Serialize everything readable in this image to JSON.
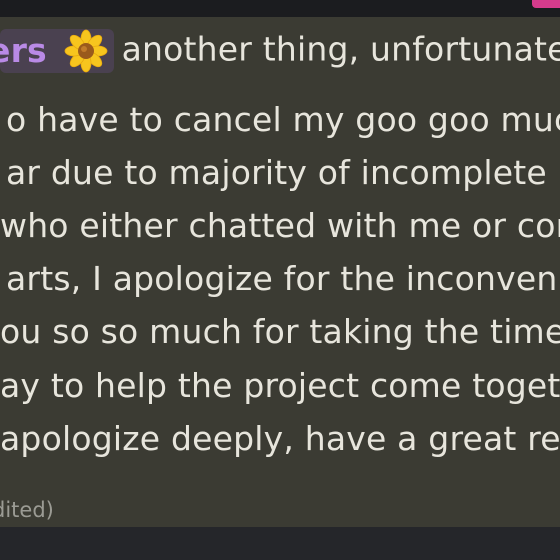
{
  "colors": {
    "message_bg": "#3b3b33",
    "text": "#e7e5dc",
    "role_text": "#b98ae6",
    "role_chip_bg": "#4a4150",
    "muted": "#9b9b94",
    "accent": "#d63b8c"
  },
  "message": {
    "role_tag": "ers",
    "role_icon": "sunflower-icon",
    "lines": [
      "another thing, unfortunate",
      "o have to cancel my goo goo much",
      "ar due to majority of incomplete p",
      "who either chatted with me or cor",
      "arts, I apologize for the inconvenic",
      "ou so so much for taking the time",
      "ay to help the project come toget",
      " apologize deeply, have a great re"
    ],
    "edited_label": "dited)"
  }
}
